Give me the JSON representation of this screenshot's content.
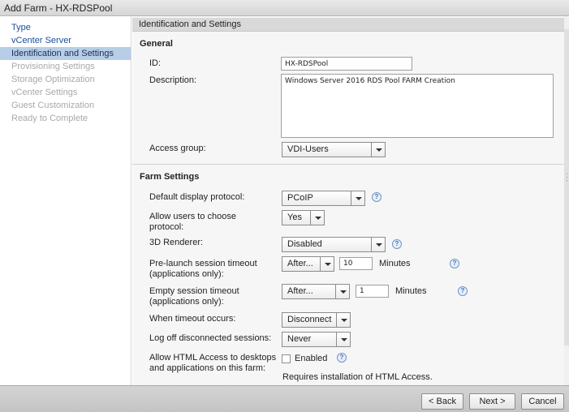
{
  "window": {
    "title": "Add Farm - HX-RDSPool"
  },
  "sidebar": {
    "items": [
      {
        "label": "Type",
        "state": "done"
      },
      {
        "label": "vCenter Server",
        "state": "done"
      },
      {
        "label": "Identification and Settings",
        "state": "active"
      },
      {
        "label": "Provisioning Settings",
        "state": "pending"
      },
      {
        "label": "Storage Optimization",
        "state": "pending"
      },
      {
        "label": "vCenter Settings",
        "state": "pending"
      },
      {
        "label": "Guest Customization",
        "state": "pending"
      },
      {
        "label": "Ready to Complete",
        "state": "pending"
      }
    ]
  },
  "main": {
    "header": "Identification and Settings",
    "general": {
      "title": "General",
      "id_label": "ID:",
      "id_value": "HX-RDSPool",
      "description_label": "Description:",
      "description_value": "Windows Server 2016 RDS Pool FARM Creation",
      "access_group_label": "Access group:",
      "access_group_value": "VDI-Users"
    },
    "farm": {
      "title": "Farm Settings",
      "display_protocol_label": "Default display protocol:",
      "display_protocol_value": "PCoIP",
      "allow_choose_label_1": "Allow users to choose",
      "allow_choose_label_2": "protocol:",
      "allow_choose_value": "Yes",
      "renderer_label": "3D Renderer:",
      "renderer_value": "Disabled",
      "prelaunch_label_1": "Pre-launch session timeout",
      "prelaunch_label_2": "(applications only):",
      "prelaunch_mode": "After...",
      "prelaunch_minutes": "10",
      "prelaunch_unit": "Minutes",
      "empty_label_1": "Empty session timeout",
      "empty_label_2": "(applications only):",
      "empty_mode": "After...",
      "empty_minutes": "1",
      "empty_unit": "Minutes",
      "timeout_action_label": "When timeout occurs:",
      "timeout_action_value": "Disconnect",
      "logoff_label": "Log off disconnected sessions:",
      "logoff_value": "Never",
      "html_access_label_1": "Allow HTML Access to desktops",
      "html_access_label_2": "and applications on this farm:",
      "html_access_checkbox_label": "Enabled",
      "html_access_checked": false,
      "html_access_note": "Requires installation of HTML Access."
    }
  },
  "footer": {
    "back_label": "< Back",
    "next_label": "Next >",
    "cancel_label": "Cancel"
  },
  "colors": {
    "active_item_bg": "#b8cde6",
    "done_item_text": "#1d4ea0",
    "pending_item_text": "#a9a9a9",
    "help_icon": "#4a74b0"
  }
}
